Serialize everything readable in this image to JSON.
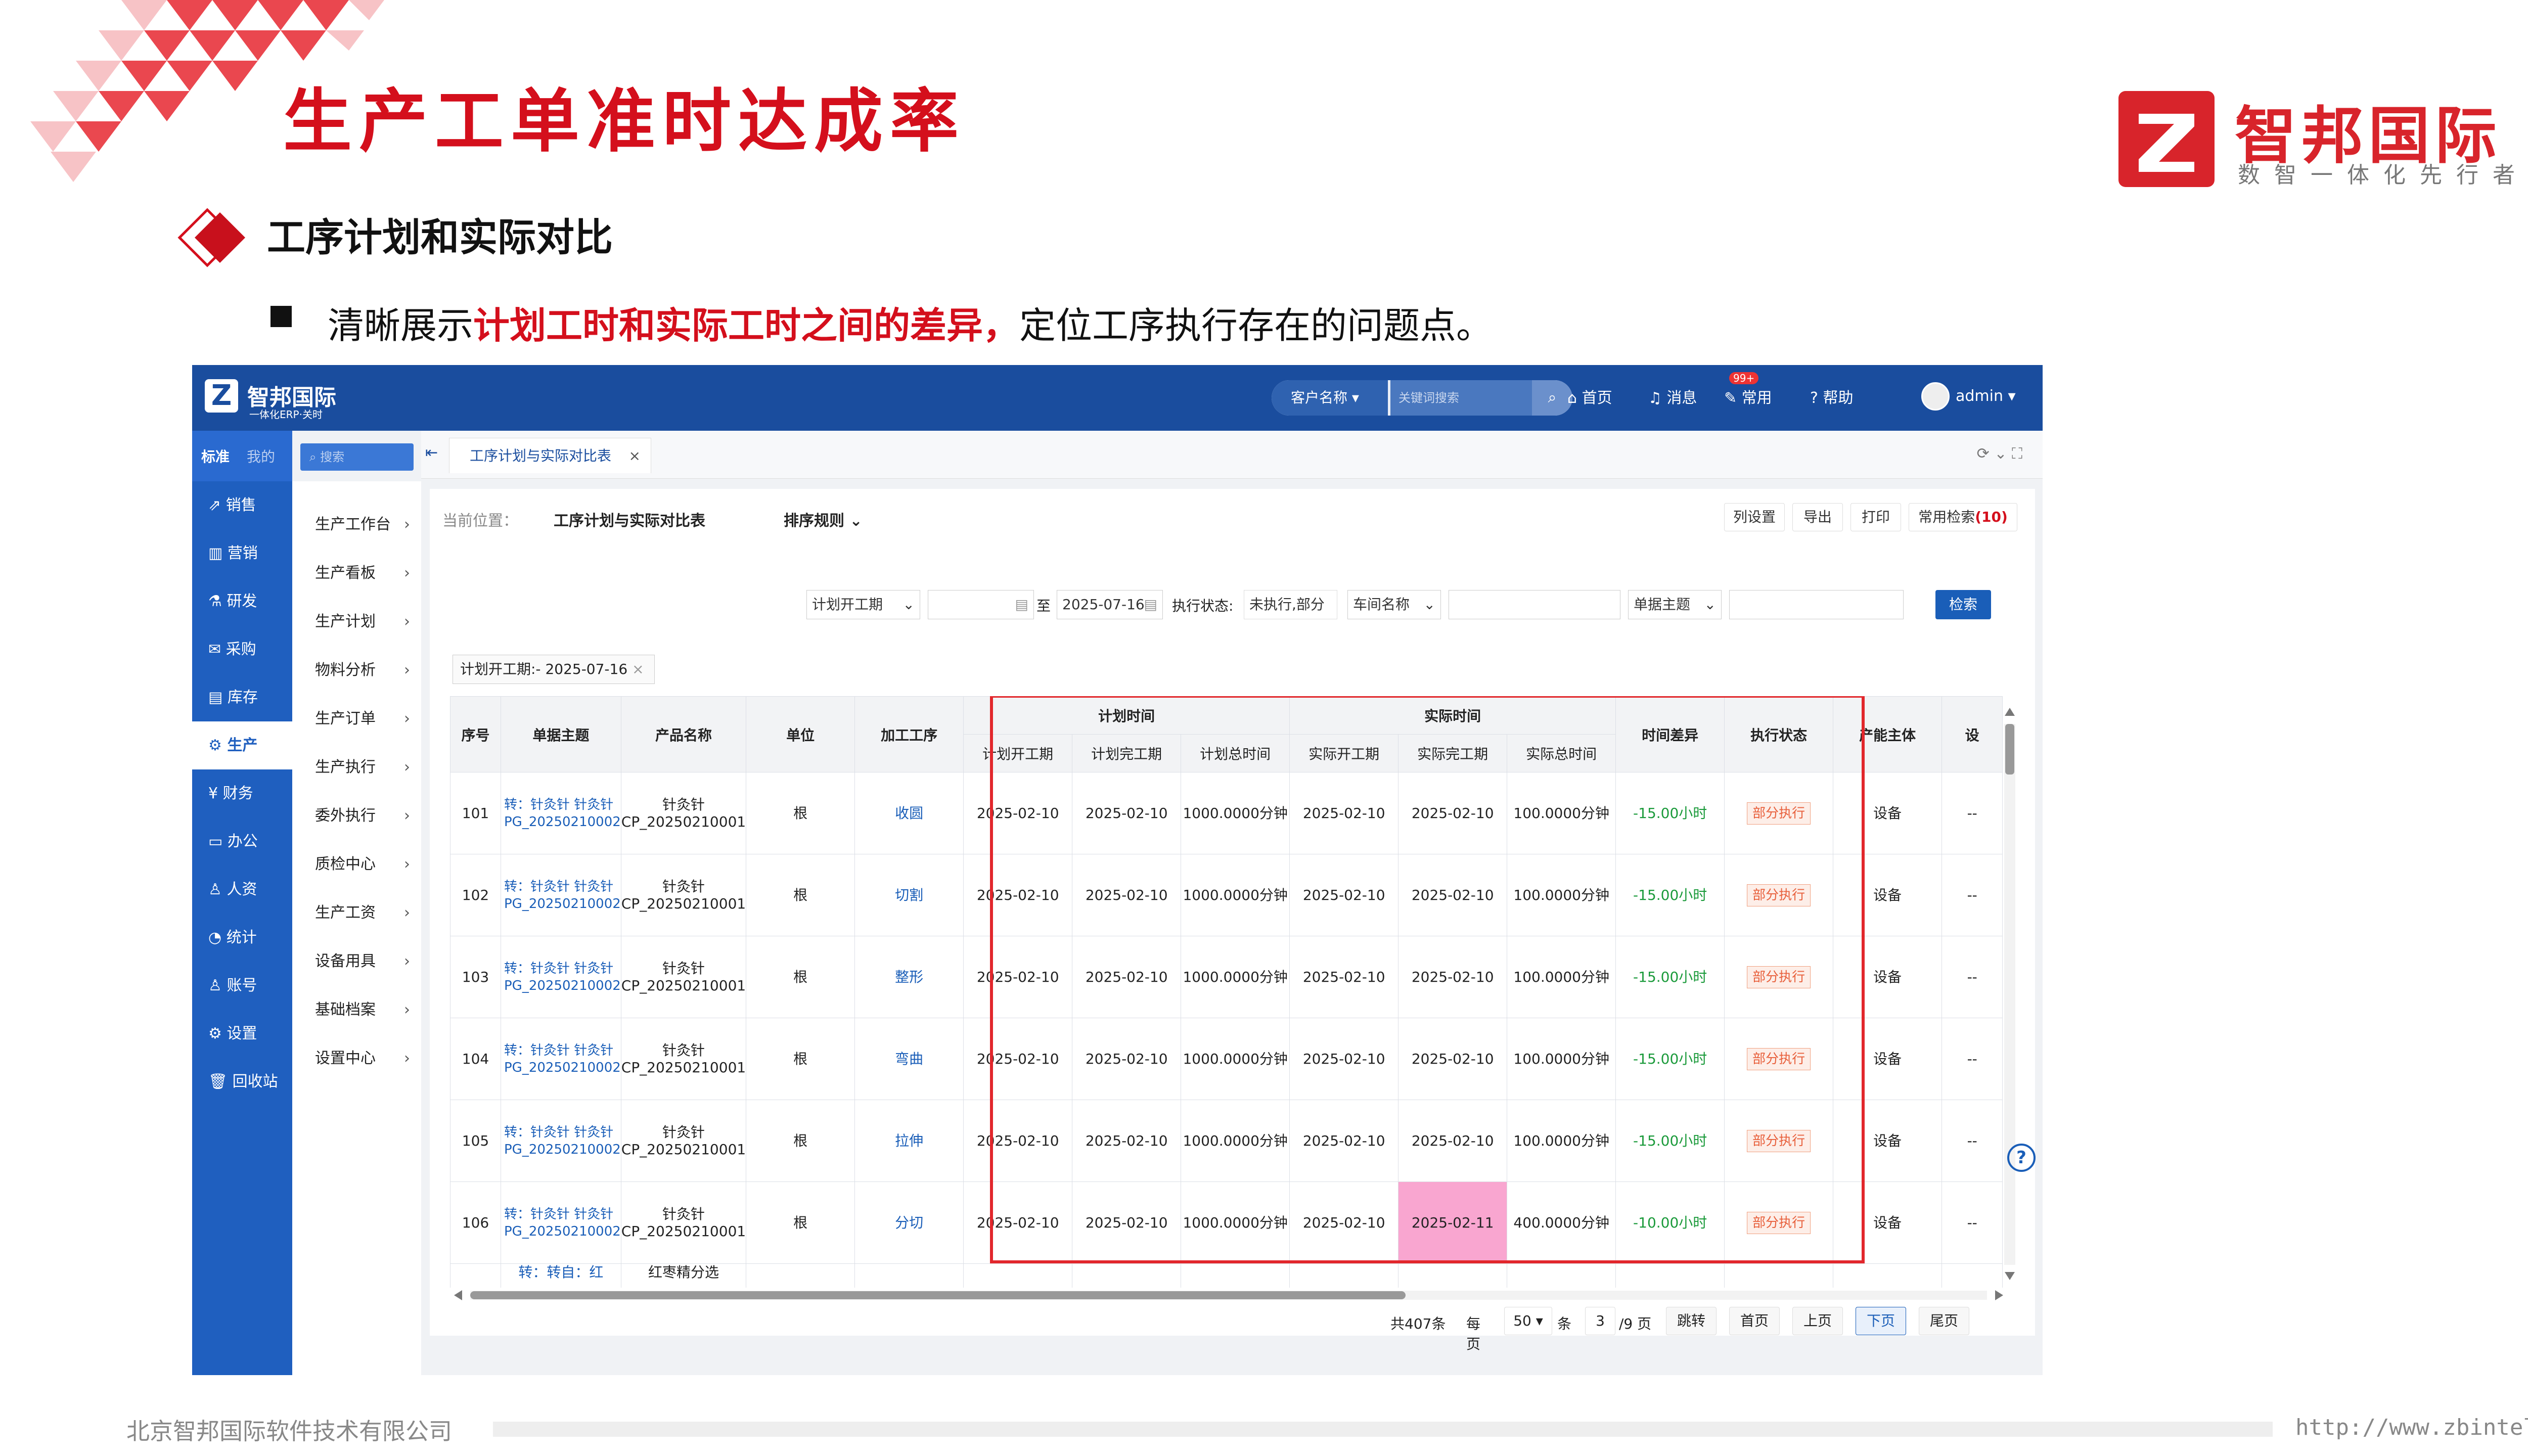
{
  "slide": {
    "title": "生产工单准时达成率",
    "logo_name": "智邦国际",
    "logo_slogan": "数智一体化先行者",
    "section_title": "工序计划和实际对比",
    "bullet_plain_1": "清晰展示",
    "bullet_highlight": "计划工时和实际工时之间的差异，",
    "bullet_plain_2": "定位工序执行存在的问题点。",
    "footer_company": "北京智邦国际软件技术有限公司",
    "footer_url": "http://www.zbintel.com",
    "colors": {
      "brand_red": "#d40f1c",
      "app_blue": "#1a4d9e",
      "highlight_box": "#e2272c",
      "late_cell": "#f9a6d0"
    }
  },
  "app": {
    "logo_name": "智邦国际",
    "logo_sub": "一体化ERP·关时",
    "search_scope": "客户名称",
    "search_placeholder": "关键词搜索",
    "nav": {
      "home": "首页",
      "messages": "消息",
      "messages_badge": "99+",
      "common": "常用",
      "help": "帮助",
      "user": "admin"
    },
    "sidebar_tabs": {
      "standard": "标准",
      "mine": "我的"
    },
    "sidebar_search": "搜索",
    "sidebar_main": [
      "销售",
      "营销",
      "研发",
      "采购",
      "库存",
      "生产",
      "财务",
      "办公",
      "人资",
      "统计",
      "账号",
      "设置",
      "回收站"
    ],
    "sidebar_main_active": "生产",
    "sidebar_sub": [
      "生产工作台",
      "生产看板",
      "生产计划",
      "物料分析",
      "生产订单",
      "生产执行",
      "委外执行",
      "质检中心",
      "生产工资",
      "设备用具",
      "基础档案",
      "设置中心"
    ],
    "tab": "工序计划与实际对比表",
    "breadcrumb_label": "当前位置：",
    "breadcrumb_value": "工序计划与实际对比表",
    "sort_label": "排序规则",
    "toolbar": {
      "columns": "列设置",
      "export": "导出",
      "print": "打印",
      "saved_search": "常用检索",
      "saved_count": "(10)"
    },
    "filters": {
      "date_field": "计划开工期",
      "date_from": "",
      "date_to_label": "至",
      "date_to": "2025-07-16",
      "exec_status_label": "执行状态:",
      "exec_status_value": "未执行,部分",
      "workshop_field": "车间名称",
      "workshop_value": "",
      "doc_field": "单据主题",
      "doc_value": "",
      "search_btn": "检索"
    },
    "filter_tag": "计划开工期:- 2025-07-16",
    "table": {
      "headers": {
        "seq": "序号",
        "doc": "单据主题",
        "product": "产品名称",
        "unit": "单位",
        "process": "加工工序",
        "plan_group": "计划时间",
        "plan_start": "计划开工期",
        "plan_end": "计划完工期",
        "plan_total": "计划总时间",
        "actual_group": "实际时间",
        "actual_start": "实际开工期",
        "actual_end": "实际完工期",
        "actual_total": "实际总时间",
        "diff": "时间差异",
        "status": "执行状态",
        "owner": "产能主体",
        "more": "设"
      },
      "rows": [
        {
          "seq": "101",
          "doc": "转：针灸针 针灸针 PG_20250210002",
          "product": "针灸针 CP_20250210001",
          "unit": "根",
          "process": "收圆",
          "plan_start": "2025-02-10",
          "plan_end": "2025-02-10",
          "plan_total": "1000.0000分钟",
          "actual_start": "2025-02-10",
          "actual_end": "2025-02-10",
          "actual_total": "100.0000分钟",
          "diff": "-15.00小时",
          "status": "部分执行",
          "owner": "设备",
          "more": "--"
        },
        {
          "seq": "102",
          "doc": "转：针灸针 针灸针 PG_20250210002",
          "product": "针灸针 CP_20250210001",
          "unit": "根",
          "process": "切割",
          "plan_start": "2025-02-10",
          "plan_end": "2025-02-10",
          "plan_total": "1000.0000分钟",
          "actual_start": "2025-02-10",
          "actual_end": "2025-02-10",
          "actual_total": "100.0000分钟",
          "diff": "-15.00小时",
          "status": "部分执行",
          "owner": "设备",
          "more": "--"
        },
        {
          "seq": "103",
          "doc": "转：针灸针 针灸针 PG_20250210002",
          "product": "针灸针 CP_20250210001",
          "unit": "根",
          "process": "整形",
          "plan_start": "2025-02-10",
          "plan_end": "2025-02-10",
          "plan_total": "1000.0000分钟",
          "actual_start": "2025-02-10",
          "actual_end": "2025-02-10",
          "actual_total": "100.0000分钟",
          "diff": "-15.00小时",
          "status": "部分执行",
          "owner": "设备",
          "more": "--"
        },
        {
          "seq": "104",
          "doc": "转：针灸针 针灸针 PG_20250210002",
          "product": "针灸针 CP_20250210001",
          "unit": "根",
          "process": "弯曲",
          "plan_start": "2025-02-10",
          "plan_end": "2025-02-10",
          "plan_total": "1000.0000分钟",
          "actual_start": "2025-02-10",
          "actual_end": "2025-02-10",
          "actual_total": "100.0000分钟",
          "diff": "-15.00小时",
          "status": "部分执行",
          "owner": "设备",
          "more": "--"
        },
        {
          "seq": "105",
          "doc": "转：针灸针 针灸针 PG_20250210002",
          "product": "针灸针 CP_20250210001",
          "unit": "根",
          "process": "拉伸",
          "plan_start": "2025-02-10",
          "plan_end": "2025-02-10",
          "plan_total": "1000.0000分钟",
          "actual_start": "2025-02-10",
          "actual_end": "2025-02-10",
          "actual_total": "100.0000分钟",
          "diff": "-15.00小时",
          "status": "部分执行",
          "owner": "设备",
          "more": "--"
        },
        {
          "seq": "106",
          "doc": "转：针灸针 针灸针 PG_20250210002",
          "product": "针灸针 CP_20250210001",
          "unit": "根",
          "process": "分切",
          "plan_start": "2025-02-10",
          "plan_end": "2025-02-10",
          "plan_total": "1000.0000分钟",
          "actual_start": "2025-02-10",
          "actual_end": "2025-02-11",
          "actual_total": "400.0000分钟",
          "diff": "-10.00小时",
          "status": "部分执行",
          "owner": "设备",
          "more": "--"
        }
      ],
      "partial_row": {
        "doc": "转：转自：红",
        "product": "红枣精分选"
      }
    },
    "pager": {
      "total": "共407条",
      "per_page_label": "每页",
      "per_page": "50",
      "unit": "条",
      "page": "3",
      "pages": "/9 页",
      "jump": "跳转",
      "first": "首页",
      "prev": "上页",
      "next": "下页",
      "last": "尾页"
    }
  }
}
